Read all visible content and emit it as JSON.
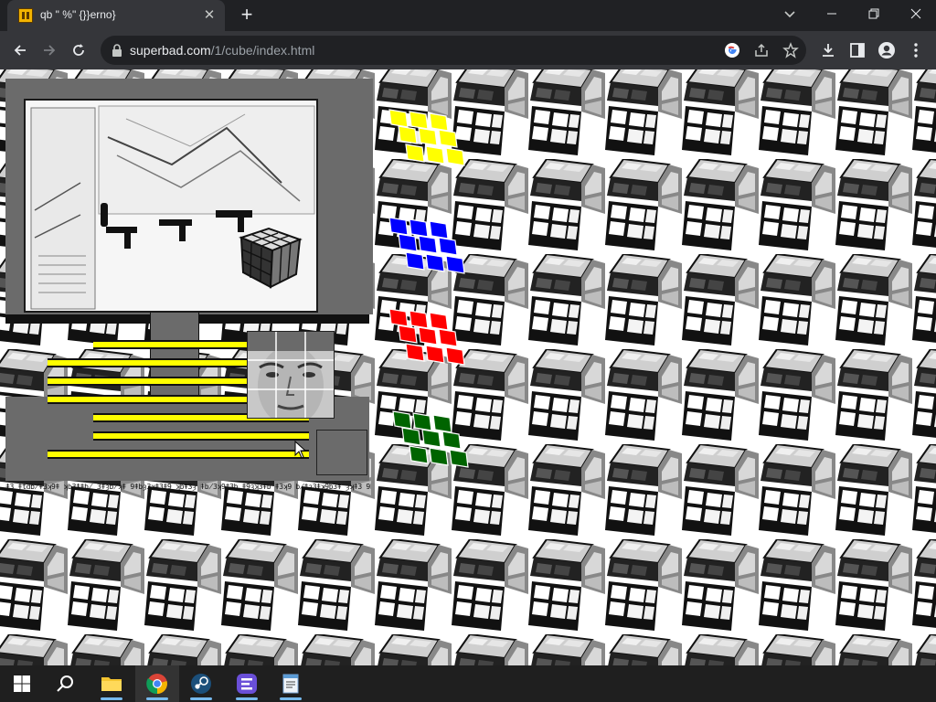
{
  "browser": {
    "tab": {
      "title": "qb \" %\" {}}erno}",
      "close_glyph": "✕"
    },
    "new_tab_glyph": "+",
    "url": {
      "host": "superbad.com",
      "path": "/1/cube/index.html"
    },
    "window_controls": [
      "minimize",
      "restore",
      "close"
    ]
  },
  "page": {
    "background": "tiled monochrome rubik cubes",
    "garbled_text": "ǂ3 ǂtdb̸ǂ3ʞ9ǂ ʞb3ǂǂb̸ 3ǂȝb̸ʞǂ 9ǂbȝ3ʞǂ3ǂ9 ʞbǂ3ȝ ǂb̸3ʞ9ǂ3b ǂ9ȝʞ3ǂb ǂ3ʞ9 b̸ǂȝ3ǂʞ9b3ǂ ȝʞǂ3 9bǂʞ3ǂ",
    "color_cubes": [
      {
        "name": "yellow",
        "color": "#ffff00"
      },
      {
        "name": "blue",
        "color": "#0000ff"
      },
      {
        "name": "red",
        "color": "#ff0000"
      },
      {
        "name": "green",
        "color": "#006400"
      }
    ]
  },
  "taskbar": {
    "items": [
      "start",
      "search",
      "file-explorer",
      "chrome",
      "steam",
      "app-purple",
      "notepad"
    ],
    "active": "chrome"
  }
}
